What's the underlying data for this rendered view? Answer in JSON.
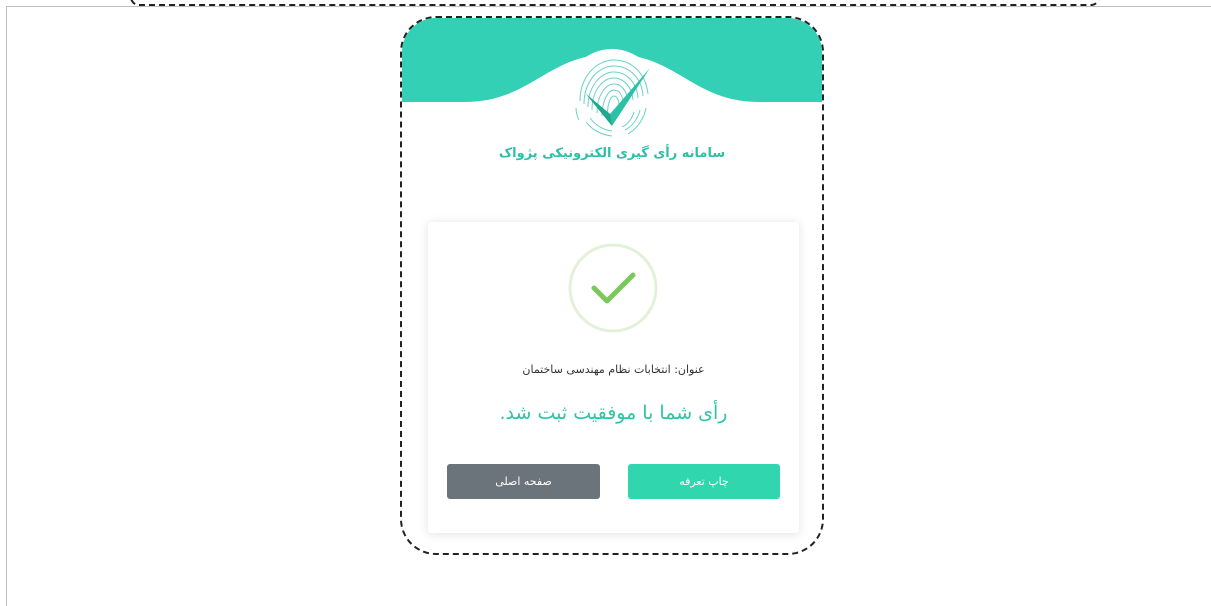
{
  "header": {
    "system_title": "سامانه رأی گیری الکترونیکی پژواک"
  },
  "result": {
    "election_title": "عنوان: انتخابات نظام مهندسی ساختمان",
    "success_message": "رأی شما با موفقیت ثبت شد.",
    "print_button_label": "چاپ تعرفه",
    "home_button_label": "صفحه اصلی"
  },
  "icons": {
    "logo": "fingerprint-check-logo",
    "success": "check-circle-icon"
  },
  "colors": {
    "brand": "#34d0b6",
    "success_green": "#7cc85b",
    "print_button": "#2fd6ae",
    "home_button": "#6c747b",
    "message_text": "#2dc4a8"
  }
}
